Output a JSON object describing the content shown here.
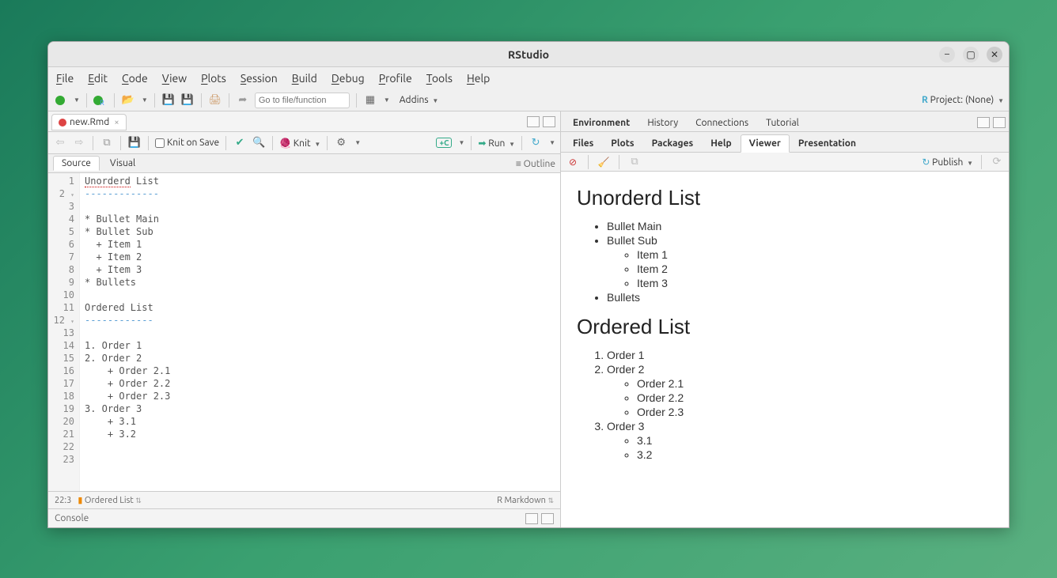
{
  "window": {
    "title": "RStudio"
  },
  "menu": {
    "file": "File",
    "edit": "Edit",
    "code": "Code",
    "view": "View",
    "plots": "Plots",
    "session": "Session",
    "build": "Build",
    "debug": "Debug",
    "profile": "Profile",
    "tools": "Tools",
    "help": "Help"
  },
  "toolbar": {
    "goto_placeholder": "Go to file/function",
    "addins": "Addins",
    "project_label": "Project: (None)"
  },
  "file_tab": {
    "name": "new.Rmd"
  },
  "editor_toolbar": {
    "knit_on_save": "Knit on Save",
    "knit": "Knit",
    "run": "Run"
  },
  "view_tabs": {
    "source": "Source",
    "visual": "Visual",
    "outline": "Outline"
  },
  "code_lines": [
    "Unorderd List",
    "-------------",
    "",
    "* Bullet Main",
    "* Bullet Sub",
    "  + Item 1",
    "  + Item 2",
    "  + Item 3",
    "* Bullets",
    "",
    "Ordered List",
    "------------",
    "",
    "1. Order 1",
    "2. Order 2",
    "    + Order 2.1",
    "    + Order 2.2",
    "    + Order 2.3",
    "3. Order 3",
    "    + 3.1",
    "    + 3.2",
    "",
    ""
  ],
  "statusbar": {
    "pos": "22:3",
    "section": "Ordered List",
    "mode": "R Markdown"
  },
  "console": {
    "label": "Console"
  },
  "env_tabs": {
    "environment": "Environment",
    "history": "History",
    "connections": "Connections",
    "tutorial": "Tutorial"
  },
  "viewer_tabs": {
    "files": "Files",
    "plots": "Plots",
    "packages": "Packages",
    "help": "Help",
    "viewer": "Viewer",
    "presentation": "Presentation"
  },
  "viewer_toolbar": {
    "publish": "Publish"
  },
  "viewer": {
    "h1": "Unorderd List",
    "b1": "Bullet Main",
    "b2": "Bullet Sub",
    "b2_1": "Item 1",
    "b2_2": "Item 2",
    "b2_3": "Item 3",
    "b3": "Bullets",
    "h2": "Ordered List",
    "o1": "Order 1",
    "o2": "Order 2",
    "o2_1": "Order 2.1",
    "o2_2": "Order 2.2",
    "o2_3": "Order 2.3",
    "o3": "Order 3",
    "o3_1": "3.1",
    "o3_2": "3.2"
  }
}
